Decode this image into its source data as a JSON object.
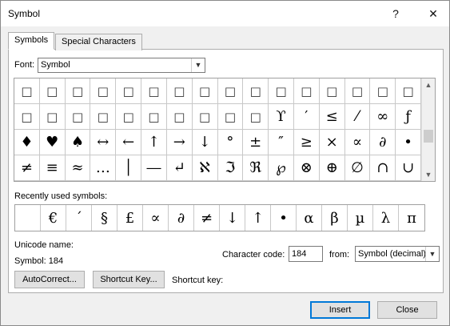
{
  "window": {
    "title": "Symbol",
    "help_glyph": "?",
    "close_glyph": "✕"
  },
  "tabs": [
    {
      "label": "Symbols",
      "active": true
    },
    {
      "label": "Special Characters",
      "active": false
    }
  ],
  "font": {
    "label": "Font:",
    "value": "Symbol"
  },
  "symbol_grid": {
    "selected": "÷",
    "rows": [
      [
        "□",
        "□",
        "□",
        "□",
        "□",
        "□",
        "□",
        "□",
        "□",
        "□",
        "□",
        "□",
        "□",
        "□",
        "□",
        "□"
      ],
      [
        "□",
        "□",
        "□",
        "□",
        "□",
        "□",
        "□",
        "□",
        "□",
        "□",
        "ϒ",
        "′",
        "≤",
        "⁄",
        "∞",
        "ƒ",
        "♣"
      ],
      [
        "♦",
        "♥",
        "♠",
        "↔",
        "←",
        "↑",
        "→",
        "↓",
        "°",
        "±",
        "″",
        "≥",
        "×",
        "∝",
        "∂",
        "•",
        "÷"
      ],
      [
        "≠",
        "≡",
        "≈",
        "…",
        "│",
        "―",
        "↵",
        "ℵ",
        "ℑ",
        "ℜ",
        "℘",
        "⊗",
        "⊕",
        "∅",
        "∩",
        "∪",
        "⊃"
      ]
    ]
  },
  "recently_used": {
    "label": "Recently used symbols:",
    "symbols": [
      "",
      "€",
      "´",
      "§",
      "£",
      "∝",
      "∂",
      "≠",
      "↓",
      "↑",
      "•",
      "α",
      "β",
      "µ",
      "λ",
      "π",
      "∞"
    ]
  },
  "unicode_name_label": "Unicode name:",
  "symbol_info": "Symbol: 184",
  "character_code": {
    "label": "Character code:",
    "value": "184"
  },
  "from": {
    "label": "from:",
    "value": "Symbol (decimal)"
  },
  "buttons": {
    "autocorrect": "AutoCorrect...",
    "shortcut_key": "Shortcut Key...",
    "insert": "Insert",
    "close": "Close"
  },
  "shortcut_key_label": "Shortcut key:"
}
